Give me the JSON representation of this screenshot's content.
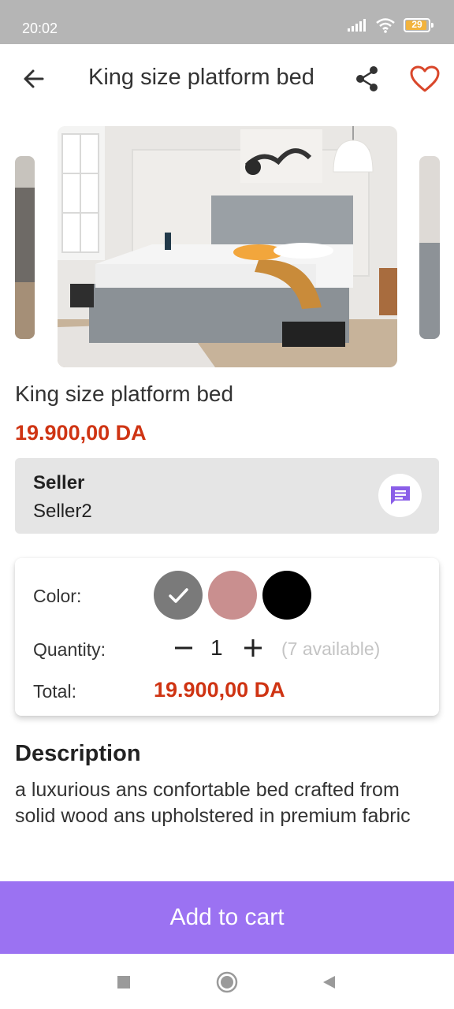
{
  "status_bar": {
    "time": "20:02",
    "battery": "29"
  },
  "header": {
    "title": "King size platform bed",
    "back_icon": "arrow-left-icon",
    "share_icon": "share-icon",
    "favorite_icon": "heart-outline-icon"
  },
  "product": {
    "name": "King size platform bed",
    "price": "19.900,00 DA"
  },
  "seller": {
    "label": "Seller",
    "name": "Seller2",
    "chat_icon": "chat-icon"
  },
  "options": {
    "color_label": "Color:",
    "colors": [
      "#7a7a7a",
      "#c98f8f",
      "#000000"
    ],
    "selected_color_index": 0,
    "quantity_label": "Quantity:",
    "quantity": "1",
    "available": "(7 available)",
    "total_label": "Total:",
    "total": "19.900,00 DA"
  },
  "description": {
    "title": "Description",
    "text": "a luxurious ans confortable bed crafted from solid wood ans upholstered in premium fabric"
  },
  "cart": {
    "label": "Add to cart"
  },
  "colors": {
    "accent": "#9b72f2",
    "price": "#cf3413",
    "favorite": "#d9472b"
  }
}
